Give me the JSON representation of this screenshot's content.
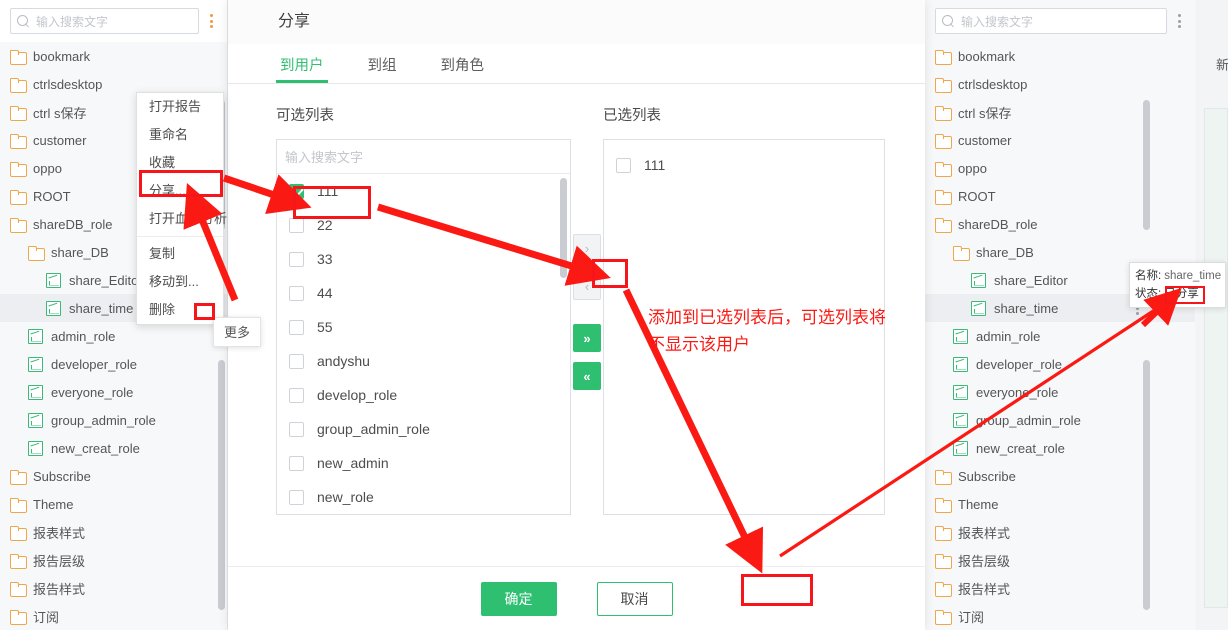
{
  "left_panel": {
    "search": {
      "placeholder": "输入搜索文字",
      "icon": "search-icon"
    },
    "menu_icon": "kebab-menu-icon",
    "tree": [
      {
        "label": "bookmark",
        "icon": "folder-icon",
        "indent": 0,
        "selected": false
      },
      {
        "label": "ctrlsdesktop",
        "icon": "folder-icon",
        "indent": 0,
        "selected": false
      },
      {
        "label": "ctrl s保存",
        "icon": "folder-icon",
        "indent": 0,
        "selected": false
      },
      {
        "label": "customer",
        "icon": "folder-icon",
        "indent": 0,
        "selected": false
      },
      {
        "label": "oppo",
        "icon": "folder-icon",
        "indent": 0,
        "selected": false
      },
      {
        "label": "ROOT",
        "icon": "folder-icon",
        "indent": 0,
        "selected": false
      },
      {
        "label": "shareDB_role",
        "icon": "folder-open-icon",
        "indent": 0,
        "selected": false
      },
      {
        "label": "share_DB",
        "icon": "folder-open-icon",
        "indent": 1,
        "selected": false
      },
      {
        "label": "share_Editor",
        "icon": "report-icon",
        "indent": 2,
        "selected": false
      },
      {
        "label": "share_time",
        "icon": "report-icon",
        "indent": 2,
        "selected": true
      },
      {
        "label": "admin_role",
        "icon": "report-icon",
        "indent": 1,
        "selected": false
      },
      {
        "label": "developer_role",
        "icon": "report-icon",
        "indent": 1,
        "selected": false
      },
      {
        "label": "everyone_role",
        "icon": "report-icon",
        "indent": 1,
        "selected": false
      },
      {
        "label": "group_admin_role",
        "icon": "report-icon",
        "indent": 1,
        "selected": false
      },
      {
        "label": "new_creat_role",
        "icon": "report-icon",
        "indent": 1,
        "selected": false
      },
      {
        "label": "Subscribe",
        "icon": "folder-icon",
        "indent": 0,
        "selected": false
      },
      {
        "label": "Theme",
        "icon": "folder-icon",
        "indent": 0,
        "selected": false
      },
      {
        "label": "报表样式",
        "icon": "folder-icon",
        "indent": 0,
        "selected": false
      },
      {
        "label": "报告层级",
        "icon": "folder-icon",
        "indent": 0,
        "selected": false
      },
      {
        "label": "报告样式",
        "icon": "folder-icon",
        "indent": 0,
        "selected": false
      },
      {
        "label": "订阅",
        "icon": "folder-icon",
        "indent": 0,
        "selected": false
      }
    ]
  },
  "context_menu": {
    "groups": [
      [
        "打开报告",
        "重命名",
        "收藏",
        "分享...",
        "打开血缘分析"
      ],
      [
        "复制",
        "移动到...",
        "删除"
      ]
    ],
    "highlighted": "分享..."
  },
  "tooltips": {
    "more": "更多",
    "share_status": {
      "name_label": "名称:",
      "name_value": "share_time",
      "state_label": "状态:",
      "state_value": "已分享"
    }
  },
  "dialog": {
    "title": "分享",
    "tabs": [
      {
        "label": "到用户",
        "active": true
      },
      {
        "label": "到组",
        "active": false
      },
      {
        "label": "到角色",
        "active": false
      }
    ],
    "available": {
      "label": "可选列表",
      "search_placeholder": "输入搜索文字",
      "items": [
        {
          "label": "111",
          "checked": true
        },
        {
          "label": "22",
          "checked": false
        },
        {
          "label": "33",
          "checked": false
        },
        {
          "label": "44",
          "checked": false
        },
        {
          "label": "55",
          "checked": false
        },
        {
          "label": "andyshu",
          "checked": false
        },
        {
          "label": "develop_role",
          "checked": false
        },
        {
          "label": "group_admin_role",
          "checked": false
        },
        {
          "label": "new_admin",
          "checked": false
        },
        {
          "label": "new_role",
          "checked": false
        }
      ]
    },
    "transfer": [
      {
        "name": "move-right-button",
        "glyph": "›",
        "style": "disabled"
      },
      {
        "name": "move-left-button",
        "glyph": "‹",
        "style": "disabled"
      },
      {
        "name": "move-all-right-button",
        "glyph": "»",
        "style": "green"
      },
      {
        "name": "move-all-left-button",
        "glyph": "«",
        "style": "green"
      }
    ],
    "selected": {
      "label": "已选列表",
      "items": [
        {
          "label": "111",
          "checked": false
        }
      ]
    },
    "footer": {
      "confirm": "确定",
      "cancel": "取消"
    }
  },
  "right_panel": {
    "search": {
      "placeholder": "输入搜索文字"
    },
    "menu_icon": "kebab-menu-icon",
    "new_button": "新",
    "tree": [
      {
        "label": "bookmark",
        "icon": "folder-icon",
        "indent": 0,
        "selected": false
      },
      {
        "label": "ctrlsdesktop",
        "icon": "folder-icon",
        "indent": 0,
        "selected": false
      },
      {
        "label": "ctrl s保存",
        "icon": "folder-icon",
        "indent": 0,
        "selected": false
      },
      {
        "label": "customer",
        "icon": "folder-icon",
        "indent": 0,
        "selected": false
      },
      {
        "label": "oppo",
        "icon": "folder-icon",
        "indent": 0,
        "selected": false
      },
      {
        "label": "ROOT",
        "icon": "folder-icon",
        "indent": 0,
        "selected": false
      },
      {
        "label": "shareDB_role",
        "icon": "folder-open-icon",
        "indent": 0,
        "selected": false
      },
      {
        "label": "share_DB",
        "icon": "folder-open-icon",
        "indent": 1,
        "selected": false
      },
      {
        "label": "share_Editor",
        "icon": "report-icon",
        "indent": 2,
        "selected": false
      },
      {
        "label": "share_time",
        "icon": "report-icon",
        "indent": 2,
        "selected": true
      },
      {
        "label": "admin_role",
        "icon": "report-icon",
        "indent": 1,
        "selected": false
      },
      {
        "label": "developer_role",
        "icon": "report-icon",
        "indent": 1,
        "selected": false
      },
      {
        "label": "everyone_role",
        "icon": "report-icon",
        "indent": 1,
        "selected": false
      },
      {
        "label": "group_admin_role",
        "icon": "report-icon",
        "indent": 1,
        "selected": false
      },
      {
        "label": "new_creat_role",
        "icon": "report-icon",
        "indent": 1,
        "selected": false
      },
      {
        "label": "Subscribe",
        "icon": "folder-icon",
        "indent": 0,
        "selected": false
      },
      {
        "label": "Theme",
        "icon": "folder-icon",
        "indent": 0,
        "selected": false
      },
      {
        "label": "报表样式",
        "icon": "folder-icon",
        "indent": 0,
        "selected": false
      },
      {
        "label": "报告层级",
        "icon": "folder-icon",
        "indent": 0,
        "selected": false
      },
      {
        "label": "报告样式",
        "icon": "folder-icon",
        "indent": 0,
        "selected": false
      },
      {
        "label": "订阅",
        "icon": "folder-icon",
        "indent": 0,
        "selected": false
      }
    ]
  },
  "annotations": {
    "note": "添加到已选列表后，可选列表将不显示该用户",
    "color": "#fb1a13"
  }
}
